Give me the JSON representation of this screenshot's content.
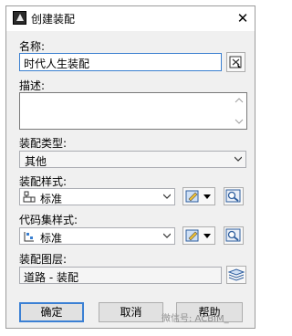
{
  "window": {
    "title": "创建装配",
    "close_glyph": "✕"
  },
  "name_field": {
    "label": "名称:",
    "value": "时代人生装配"
  },
  "description_field": {
    "label": "描述:",
    "value": ""
  },
  "assembly_type": {
    "label": "装配类型:",
    "selected": "其他"
  },
  "assembly_style": {
    "label": "装配样式:",
    "selected": "标准"
  },
  "code_set_style": {
    "label": "代码集样式:",
    "selected": "标准"
  },
  "assembly_layer": {
    "label": "装配图层:",
    "value": "道路 - 装配"
  },
  "buttons": {
    "ok": "确定",
    "cancel": "取消",
    "help": "帮助"
  },
  "watermark": {
    "text": "微信号: ACBIM_"
  },
  "colors": {
    "accent": "#3b80d4",
    "dialog_bg": "#f0f0f0"
  }
}
